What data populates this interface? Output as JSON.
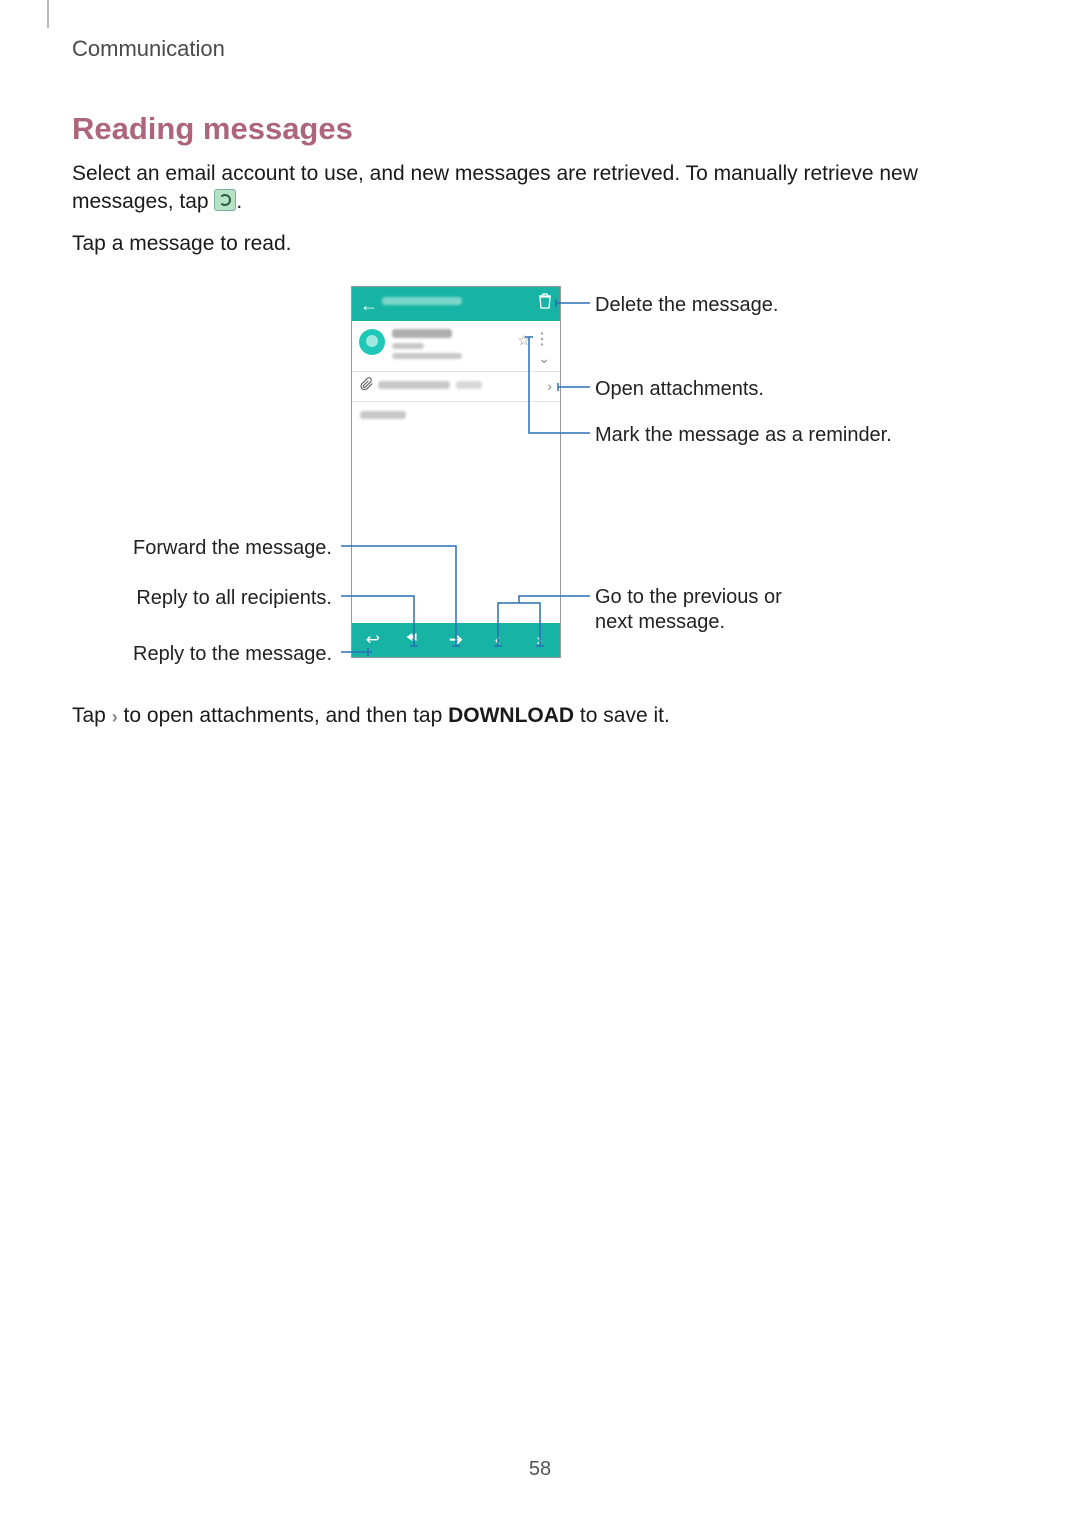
{
  "header": {
    "breadcrumb": "Communication"
  },
  "section": {
    "title": "Reading messages",
    "paragraph1_a": "Select an email account to use, and new messages are retrieved. To manually retrieve new messages, tap ",
    "paragraph1_b": ".",
    "paragraph2": "Tap a message to read.",
    "paragraph3_a": "Tap ",
    "paragraph3_b": " to open attachments, and then tap ",
    "paragraph3_bold": "DOWNLOAD",
    "paragraph3_c": " to save it."
  },
  "callouts": {
    "delete": "Delete the message.",
    "open_attachments": "Open attachments.",
    "mark_reminder": "Mark the message as a reminder.",
    "forward": "Forward the message.",
    "reply_all": "Reply to all recipients.",
    "reply": "Reply to the message.",
    "prev_next": "Go to the previous or next message."
  },
  "icons": {
    "refresh": "refresh-icon",
    "chevron": "›"
  },
  "page_number": "58"
}
